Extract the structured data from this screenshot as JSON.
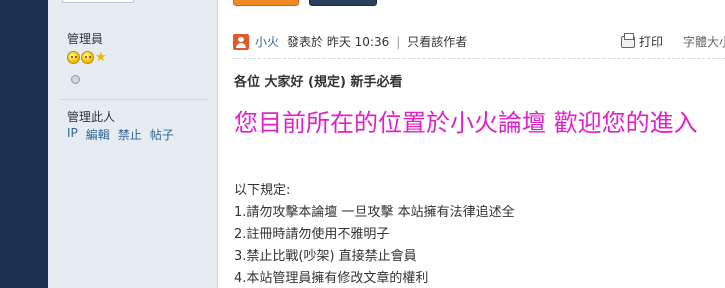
{
  "sidebar": {
    "role": "管理員",
    "manage_label": "管理此人",
    "links": [
      "IP",
      "編輯",
      "禁止",
      "帖子"
    ]
  },
  "post": {
    "author": "小火",
    "posted_at": "發表於 昨天 10:36",
    "separator": "|",
    "only_author": "只看該作者",
    "print_label": "打印",
    "font_size_label": "字體大小",
    "title": "各位 大家好 (規定) 新手必看",
    "welcome_text": "您目前所在的位置於小火論壇 歡迎您的進入",
    "welcome_color": "#e020c8",
    "rules": [
      "以下規定:",
      "1.請勿攻擊本論壇  一旦攻擊  本站擁有法律追述全",
      "2.註冊時請勿使用不雅明子",
      "3.禁止比戰(吵架) 直接禁止會員",
      "4.本站管理員擁有修改文章的權利"
    ]
  },
  "colors": {
    "sidebar_bg": "#e5edf2",
    "rail_bg": "#1c2f4e",
    "link": "#336699",
    "button_orange": "#f08a24",
    "button_navy": "#2b3e5b"
  },
  "icons": [
    "sun-rank-icon",
    "star-rank-icon",
    "online-status-icon",
    "avatar-icon",
    "printer-icon"
  ]
}
